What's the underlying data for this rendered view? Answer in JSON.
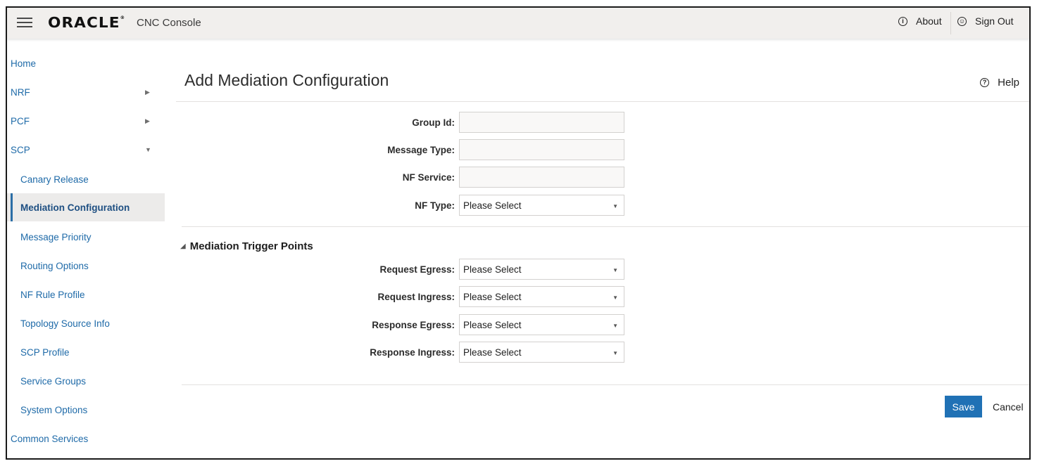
{
  "header": {
    "logo": "ORACLE",
    "product": "CNC Console",
    "about_label": "About",
    "signout_label": "Sign Out"
  },
  "sidebar": {
    "items": [
      {
        "label": "Home"
      },
      {
        "label": "NRF"
      },
      {
        "label": "PCF"
      },
      {
        "label": "SCP"
      },
      {
        "label": "Canary Release"
      },
      {
        "label": "Mediation Configuration"
      },
      {
        "label": "Message Priority"
      },
      {
        "label": "Routing Options"
      },
      {
        "label": "NF Rule Profile"
      },
      {
        "label": "Topology Source Info"
      },
      {
        "label": "SCP Profile"
      },
      {
        "label": "Service Groups"
      },
      {
        "label": "System Options"
      },
      {
        "label": "Common Services"
      }
    ]
  },
  "main": {
    "title": "Add Mediation Configuration",
    "help_label": "Help",
    "form": {
      "group_id_label": "Group Id:",
      "group_id_value": "",
      "message_type_label": "Message Type:",
      "message_type_value": "",
      "nf_service_label": "NF Service:",
      "nf_service_value": "",
      "nf_type_label": "NF Type:",
      "nf_type_value": "Please Select"
    },
    "trigger_section": {
      "title": "Mediation Trigger Points",
      "request_egress_label": "Request Egress:",
      "request_egress_value": "Please Select",
      "request_ingress_label": "Request Ingress:",
      "request_ingress_value": "Please Select",
      "response_egress_label": "Response Egress:",
      "response_egress_value": "Please Select",
      "response_ingress_label": "Response Ingress:",
      "response_ingress_value": "Please Select"
    },
    "actions": {
      "save_label": "Save",
      "cancel_label": "Cancel"
    }
  },
  "colors": {
    "accent": "#2071b5",
    "link": "#1e6aa8",
    "header_bg": "#f1efed"
  }
}
